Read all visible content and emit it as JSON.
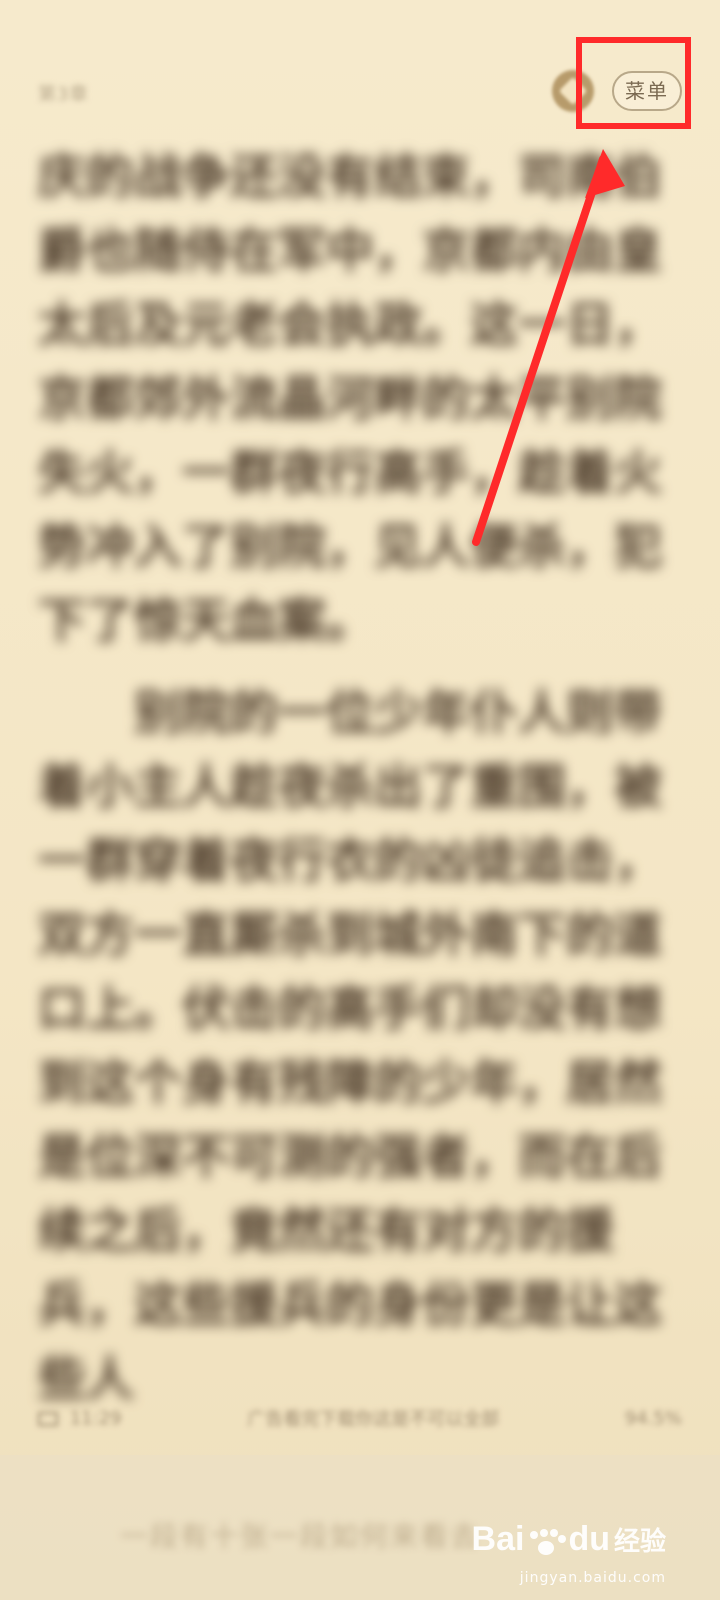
{
  "header": {
    "chapter_title": "第3章",
    "menu_label": "菜单"
  },
  "content": {
    "paragraphs": [
      "庆的战争还没有结束，司南伯爵也随侍在军中，京都内由皇太后及元老会执政。这一日，京都郊外流晶河畔的太平别院失火，一群夜行高手，趁着火势冲入了别院，见人便杀，犯下了惊天血案。",
      "别院的一位少年仆人则带着小主人趁夜杀出了重围，被一群穿着夜行衣的凶徒追击，双方一直厮杀到城外南下的道口上。伏击的高手们却没有想到这个身有残障的少年，居然是位深不可测的强者，而在后续之后，竟然还有对方的援兵，这些援兵的身份更是让这些人"
    ]
  },
  "footer": {
    "time": "11:29",
    "ad_hint": "广告看完下载你这是不可以全部",
    "progress": "94.5%"
  },
  "bottom_ad": {
    "text": "一段有十张一段如何来看去"
  },
  "watermark": {
    "brand": "Bai",
    "brand_suffix": "du",
    "jingyan": "经验",
    "domain": "jingyan.baidu.com"
  },
  "colors": {
    "background": "#f5e8c9",
    "text": "#4b3a29",
    "highlight": "#ff2a2a"
  }
}
